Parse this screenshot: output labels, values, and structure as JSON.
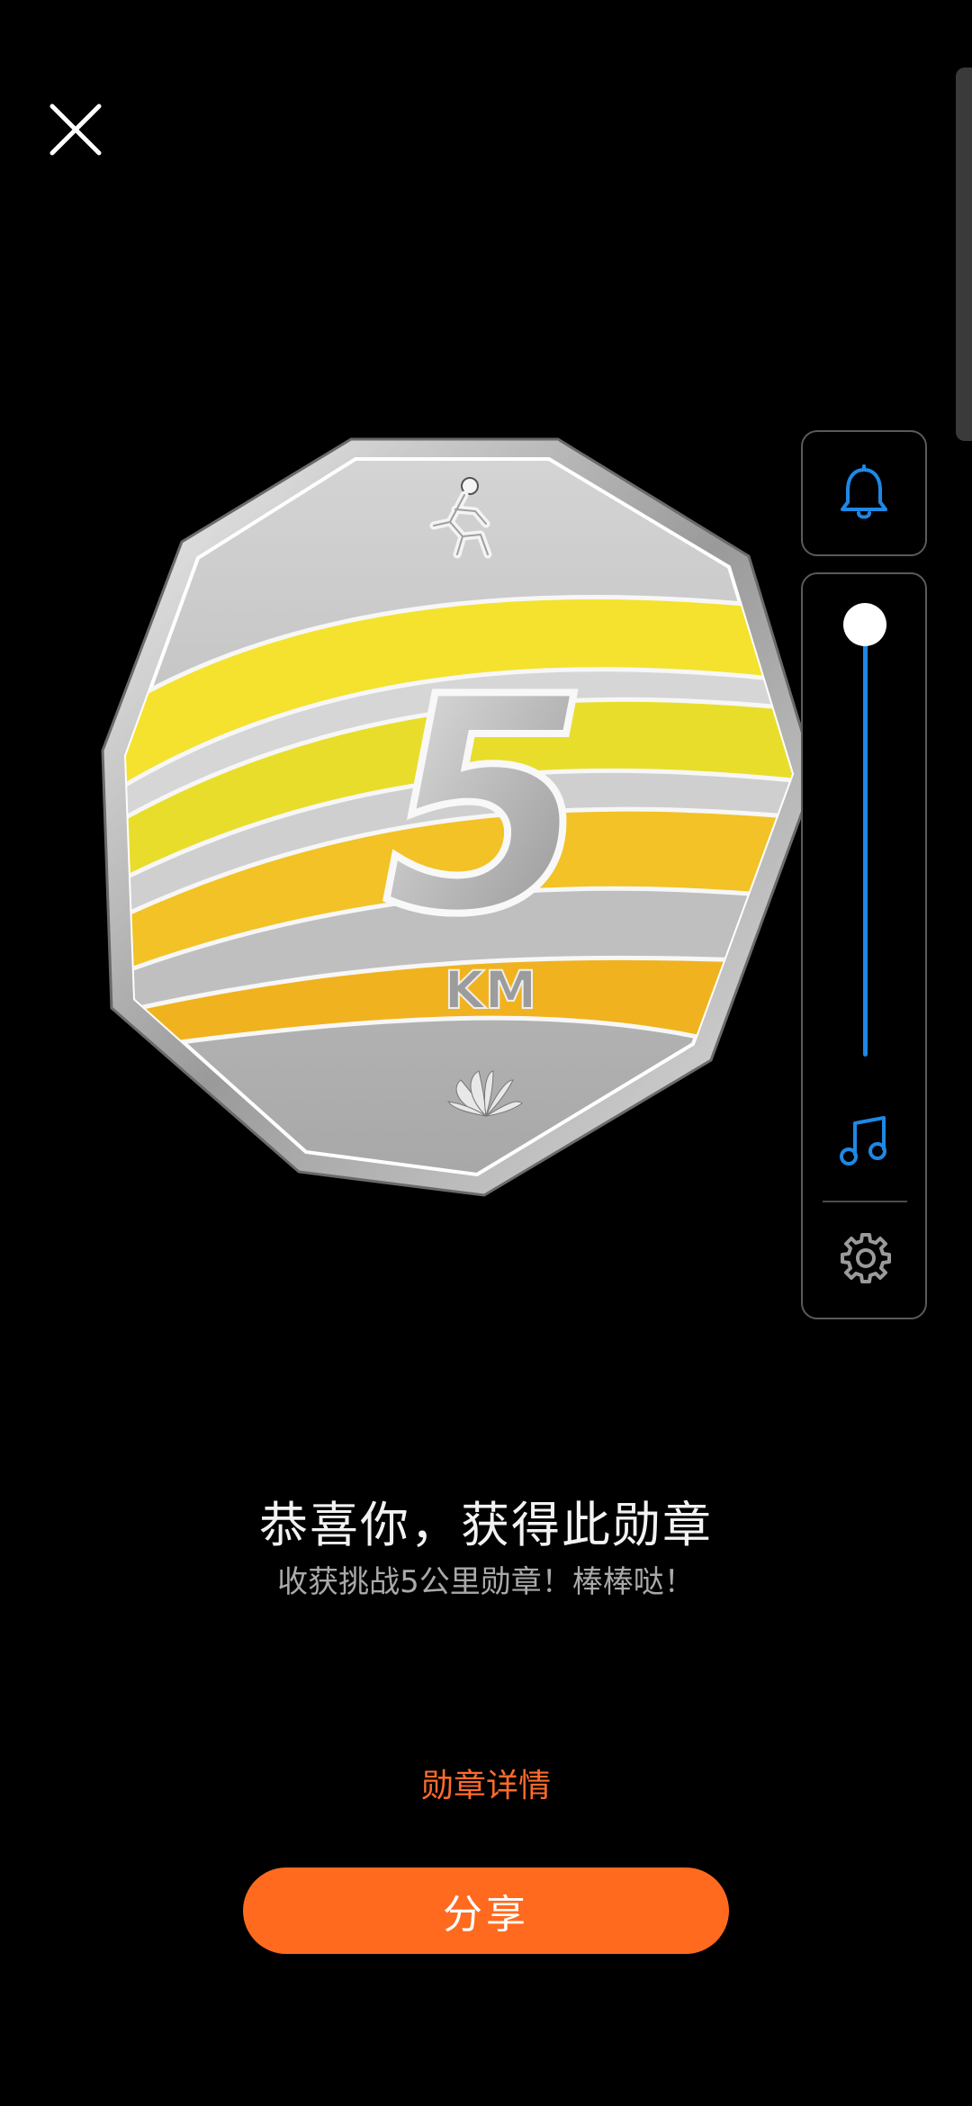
{
  "medal": {
    "distance": "5",
    "unit": "KM"
  },
  "congrats": {
    "title": "恭喜你，获得此勋章",
    "subtitle": "收获挑战5公里勋章！棒棒哒！"
  },
  "actions": {
    "detail_link": "勋章详情",
    "share_label": "分享"
  },
  "icons": {
    "close": "close-icon",
    "bell": "bell-icon",
    "music": "music-note-icon",
    "settings": "gear-icon",
    "runner": "runner-icon",
    "brand_logo": "petal-logo-icon"
  },
  "colors": {
    "accent": "#ff6a1f",
    "link": "#ff6a2b",
    "control_blue": "#1e88e5",
    "medal_yellow": "#f4dc2a",
    "medal_silver": "#c8c8c8"
  },
  "volume": {
    "level": 1.0
  }
}
